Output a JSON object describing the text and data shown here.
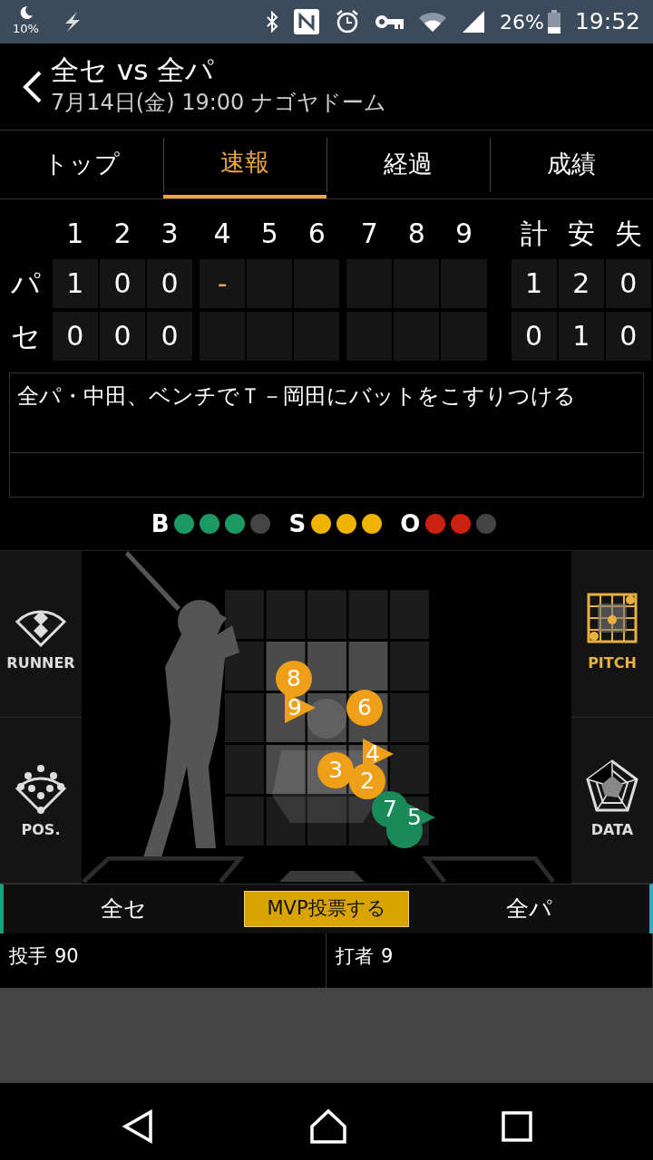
{
  "status_bar": {
    "dnd_level": "10%",
    "battery": "26%",
    "time": "19:52"
  },
  "header": {
    "title": "全セ vs 全パ",
    "subtitle": "7月14日(金) 19:00 ナゴヤドーム"
  },
  "tabs": [
    {
      "label": "トップ",
      "selected": false
    },
    {
      "label": "速報",
      "selected": true
    },
    {
      "label": "経過",
      "selected": false
    },
    {
      "label": "成績",
      "selected": false
    }
  ],
  "scoreboard": {
    "innings": [
      "1",
      "2",
      "3",
      "4",
      "5",
      "6",
      "7",
      "8",
      "9"
    ],
    "totals_headers": [
      "計",
      "安",
      "失"
    ],
    "rows": [
      {
        "team": "パ",
        "batting": true,
        "innings": [
          "1",
          "0",
          "0",
          "-"
        ],
        "totals": [
          "1",
          "2",
          "0"
        ]
      },
      {
        "team": "セ",
        "batting": false,
        "innings": [
          "0",
          "0",
          "0"
        ],
        "totals": [
          "0",
          "1",
          "0"
        ]
      }
    ]
  },
  "comment": "全パ・中田、ベンチでＴ－岡田にバットをこすりつける",
  "count": [
    {
      "label": "B",
      "lights": [
        true,
        true,
        true,
        false
      ]
    },
    {
      "label": "S",
      "lights": [
        true,
        true,
        true
      ]
    },
    {
      "label": "O",
      "lights": [
        true,
        true,
        false
      ]
    }
  ],
  "side_buttons": [
    {
      "label": "RUNNER",
      "selected": false
    },
    {
      "label": "POS.",
      "selected": false
    },
    {
      "label": "PITCH",
      "selected": true
    },
    {
      "label": "DATA",
      "selected": false
    }
  ],
  "pitches": [
    {
      "label": "8",
      "kind": "circle",
      "color": "#f0a018"
    },
    {
      "label": "9",
      "kind": "triangle",
      "color": "#f0a018"
    },
    {
      "label": "6",
      "kind": "circle",
      "color": "#f0a018"
    },
    {
      "label": "3",
      "kind": "circle",
      "color": "#f0a018"
    },
    {
      "label": "4",
      "kind": "triangle",
      "color": "#f0a018"
    },
    {
      "label": "2",
      "kind": "circle",
      "color": "#f0a018"
    },
    {
      "kind": "circle",
      "color": "#1a8a5a"
    },
    {
      "label": "7",
      "kind": "circle",
      "color": "#1a8a5a"
    },
    {
      "label": "5",
      "kind": "triangle",
      "color": "#1a8a5a"
    }
  ],
  "teams_bar": {
    "left": "全セ",
    "button": "MVP投票する",
    "right": "全パ"
  },
  "players": [
    {
      "role": "投手",
      "number": "90"
    },
    {
      "role": "打者",
      "number": "9"
    }
  ]
}
